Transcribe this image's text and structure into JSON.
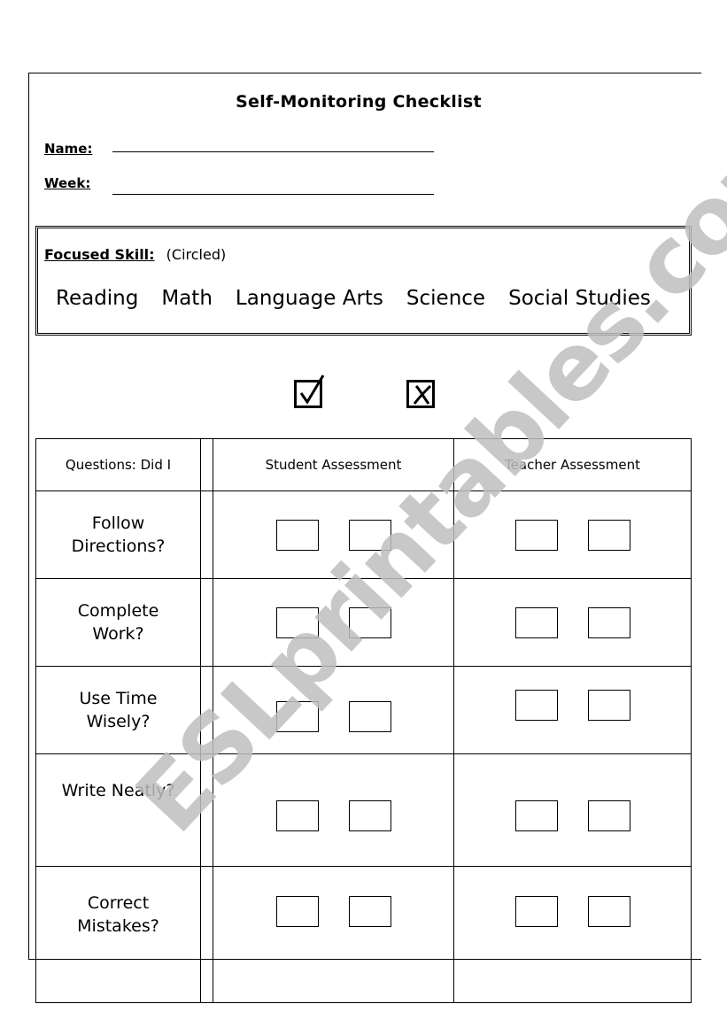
{
  "document": {
    "title": "Self-Monitoring Checklist",
    "fields": [
      {
        "label": "Name:",
        "value": ""
      },
      {
        "label": "Week:",
        "value": ""
      }
    ],
    "focused_skill": {
      "label": "Focused Skill:",
      "note": "(Circled)",
      "options": [
        "Reading",
        "Math",
        "Language Arts",
        "Science",
        "Social Studies"
      ]
    },
    "legend": [
      {
        "icon": "checkmark-box-icon",
        "meaning": "yes"
      },
      {
        "icon": "x-box-icon",
        "meaning": "no"
      }
    ],
    "table": {
      "headers": [
        "Questions:  Did I",
        "Student Assessment",
        "Teacher Assessment"
      ],
      "rows": [
        {
          "line1": "Follow",
          "line2": "Directions?"
        },
        {
          "line1": "Complete",
          "line2": "Work?"
        },
        {
          "line1": "Use Time",
          "line2": "Wisely?"
        },
        {
          "line1": "Write Neatly?",
          "line2": ""
        },
        {
          "line1": "Correct",
          "line2": "Mistakes?"
        }
      ]
    },
    "watermark": "ESLprintables.com"
  }
}
